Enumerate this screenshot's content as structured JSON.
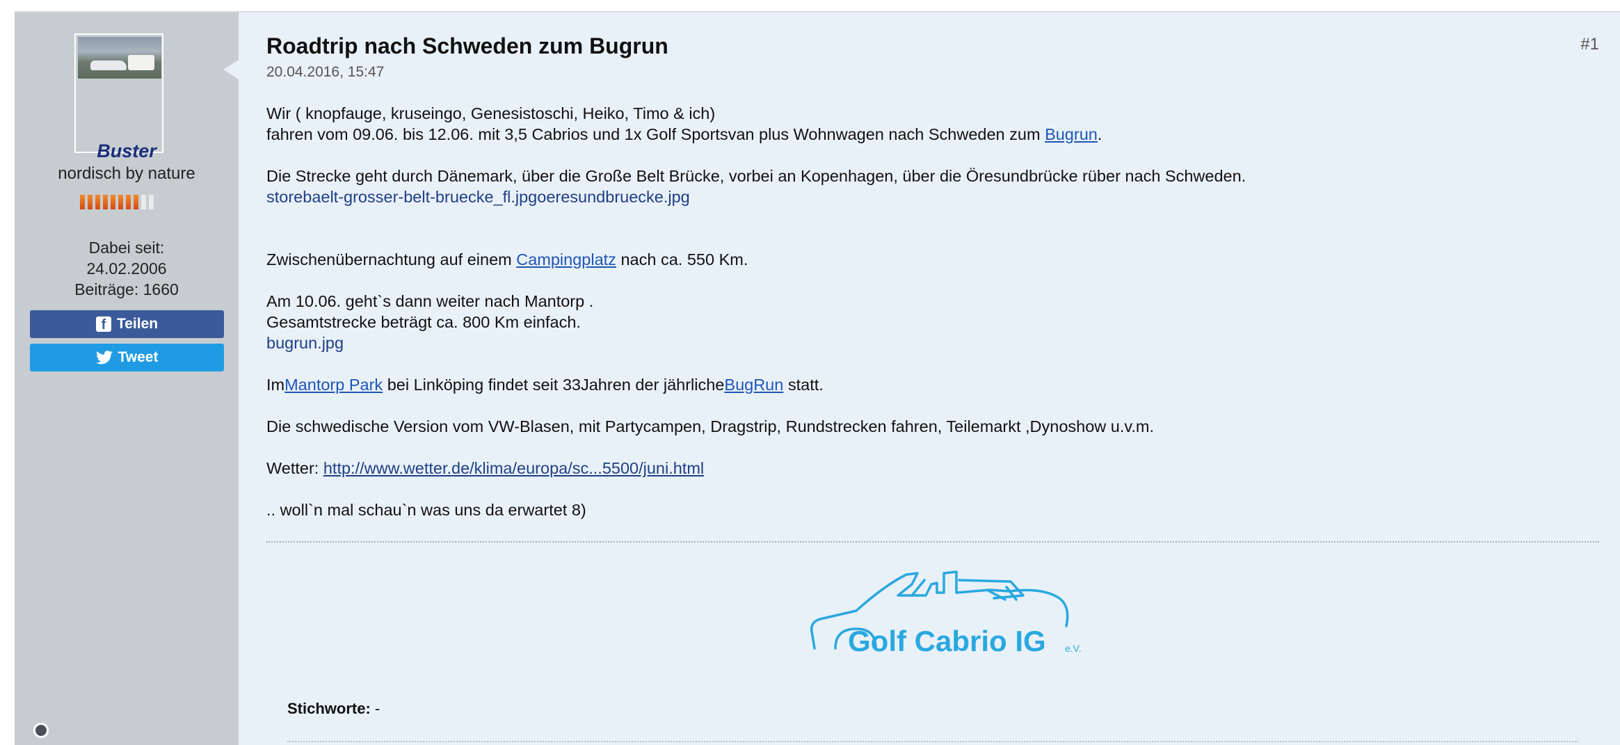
{
  "post": {
    "title": "Roadtrip nach Schweden zum Bugrun",
    "date": "20.04.2016, 15:47",
    "number": "#1"
  },
  "author": {
    "username": "Buster",
    "user_title": "nordisch by nature",
    "rank_level": 8,
    "rank_max": 10,
    "since_label": "Dabei seit:",
    "since_date": "24.02.2006",
    "posts_label": "Beiträge: 1660"
  },
  "share": {
    "facebook_label": "Teilen",
    "twitter_label": "Tweet",
    "facebook_icon": "facebook-icon",
    "twitter_icon": "twitter-icon"
  },
  "body": {
    "p1_l1": "Wir ( knopfauge, kruseingo, Genesistoschi, Heiko, Timo & ich)",
    "p1_l2_pre": "fahren vom 09.06. bis 12.06. mit 3,5 Cabrios und 1x Golf Sportsvan plus Wohnwagen nach Schweden zum ",
    "p1_l2_link": "Bugrun",
    "p1_l2_post": ".",
    "p2_l1": "Die Strecke geht durch Dänemark, über die Große Belt Brücke, vorbei an Kopenhagen, über die Öresundbrücke rüber nach Schweden.",
    "p2_attach1": "storebaelt-grosser-belt-bruecke_fl.jpg",
    "p2_attach2": "oeresundbruecke.jpg",
    "p3_pre": "Zwischenübernachtung auf einem ",
    "p3_link": "Campingplatz",
    "p3_post": " nach ca. 550 Km.",
    "p4_l1": "Am 10.06. geht`s dann weiter nach Mantorp .",
    "p4_l2": "Gesamtstrecke beträgt ca. 800 Km einfach.",
    "p4_attach": "bugrun.jpg",
    "p5_pre": "Im",
    "p5_link1": "Mantorp Park",
    "p5_mid": " bei Linköping findet seit 33Jahren der jährliche",
    "p5_link2": "BugRun",
    "p5_post": " statt.",
    "p6": "Die schwedische Version vom VW-Blasen, mit Partycampen, Dragstrip, Rundstrecken fahren, Teilemarkt ,Dynoshow u.v.m.",
    "p7_pre": "Wetter: ",
    "p7_link": "http://www.wetter.de/klima/europa/sc...5500/juni.html",
    "p8": ".. woll`n mal schau`n was uns da erwartet 8)"
  },
  "signature": {
    "logo_text": "Golf Cabrio IG",
    "logo_suffix": "e.V.",
    "logo_color": "#29a8e0"
  },
  "tags": {
    "label": "Stichworte:",
    "value": " -"
  },
  "colors": {
    "sidebar_bg": "#c7ccd1",
    "content_bg": "#e9f1f8",
    "username": "#1b2f7a",
    "link": "#1e55b8",
    "facebook": "#3b5a9a",
    "twitter": "#1f9be4"
  }
}
